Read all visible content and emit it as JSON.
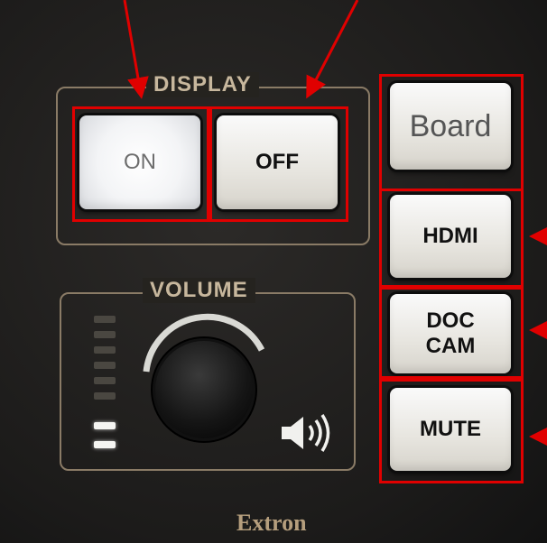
{
  "display_group": {
    "title": "DISPLAY",
    "on_label": "ON",
    "off_label": "OFF"
  },
  "volume_group": {
    "title": "VOLUME",
    "level_leds_total": 7,
    "level_leds_lit": 2
  },
  "sources": {
    "board_label": "Board",
    "hdmi_label": "HDMI",
    "doc_cam_line1": "DOC",
    "doc_cam_line2": "CAM",
    "mute_label": "MUTE"
  },
  "brand": "Extron",
  "colors": {
    "highlight": "#e00000",
    "panel": "#1c1b1a",
    "label": "#c7b79d"
  }
}
